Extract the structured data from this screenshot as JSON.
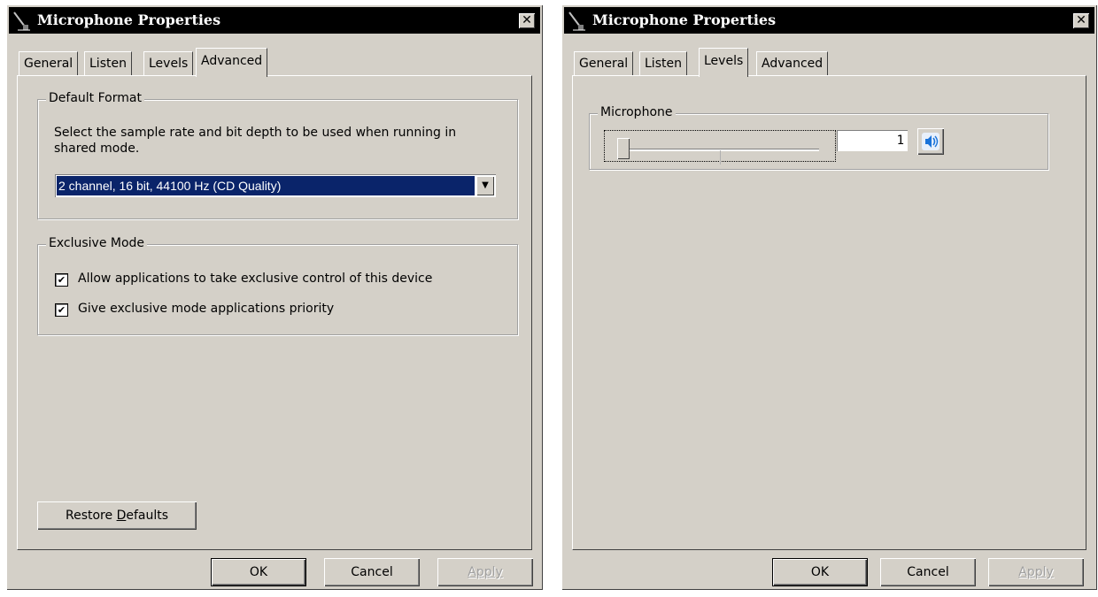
{
  "left_dialog": {
    "title": "Microphone Properties",
    "close_label": "✕",
    "tabs": [
      {
        "label": "General"
      },
      {
        "label": "Listen"
      },
      {
        "label": "Levels"
      },
      {
        "label": "Advanced",
        "active": true
      }
    ],
    "default_format": {
      "title": "Default Format",
      "description": "Select the sample rate and bit depth to be used when running in shared mode.",
      "selected": "2 channel, 16 bit, 44100 Hz (CD Quality)"
    },
    "exclusive_mode": {
      "title": "Exclusive Mode",
      "options": [
        {
          "label": "Allow applications to take exclusive control of this device",
          "checked": true
        },
        {
          "label": "Give exclusive mode applications priority",
          "checked": true
        }
      ]
    },
    "restore_defaults": {
      "pre": "Restore ",
      "accel": "D",
      "post": "efaults"
    },
    "buttons": {
      "ok": "OK",
      "cancel": "Cancel",
      "apply": "Apply"
    }
  },
  "right_dialog": {
    "title": "Microphone Properties",
    "close_label": "✕",
    "tabs": [
      {
        "label": "General"
      },
      {
        "label": "Listen"
      },
      {
        "label": "Levels",
        "active": true
      },
      {
        "label": "Advanced"
      }
    ],
    "microphone": {
      "title": "Microphone",
      "level": "1",
      "speaker_icon": "speaker-icon"
    },
    "buttons": {
      "ok": "OK",
      "cancel": "Cancel",
      "apply": "Apply"
    }
  },
  "colors": {
    "face": "#d4d0c8",
    "titlebar": "#000000",
    "selection": "#0a246a",
    "speaker_blue": "#1a73d9"
  }
}
